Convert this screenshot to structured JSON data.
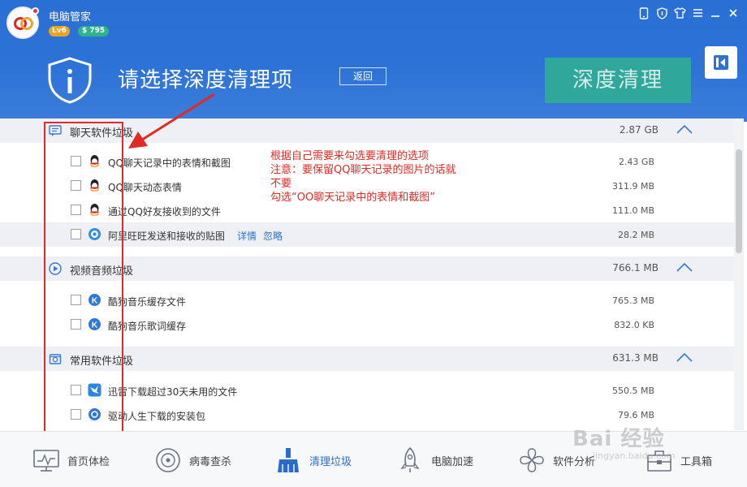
{
  "app": {
    "name": "电脑管家",
    "level_badge": "Lv6",
    "coin_badge": "$ 795"
  },
  "window_controls": [
    "phone-icon",
    "shield-icon",
    "skin-icon",
    "menu-icon",
    "minimize-icon",
    "close-icon"
  ],
  "header": {
    "title": "请选择深度清理项",
    "back_label": "返回",
    "deep_clean_label": "深度清理"
  },
  "categories": [
    {
      "label": "聊天软件垃圾",
      "size": "2.87 GB",
      "icon": "chat-icon",
      "items": [
        {
          "label": "QQ聊天记录中的表情和截图",
          "size": "2.43 GB",
          "icon": "qq-icon"
        },
        {
          "label": "QQ聊天动态表情",
          "size": "311.9 MB",
          "icon": "qq-icon"
        },
        {
          "label": "通过QQ好友接收到的文件",
          "size": "111.0 MB",
          "icon": "qq-icon"
        },
        {
          "label": "阿里旺旺发送和接收的贴图",
          "size": "28.2 MB",
          "icon": "aliwangwang-icon",
          "links": [
            "详情",
            "忽略"
          ]
        }
      ]
    },
    {
      "label": "视频音频垃圾",
      "size": "766.1 MB",
      "icon": "play-icon",
      "items": [
        {
          "label": "酷狗音乐缓存文件",
          "size": "765.3 MB",
          "icon": "kugou-icon"
        },
        {
          "label": "酷狗音乐歌词缓存",
          "size": "832.0 KB",
          "icon": "kugou-icon"
        }
      ]
    },
    {
      "label": "常用软件垃圾",
      "size": "631.3 MB",
      "icon": "software-icon",
      "items": [
        {
          "label": "迅雷下载超过30天未用的文件",
          "size": "550.5 MB",
          "icon": "xunlei-icon"
        },
        {
          "label": "驱动人生下载的安装包",
          "size": "79.6 MB",
          "icon": "driver-icon"
        }
      ]
    }
  ],
  "annotation": {
    "lines": [
      "根据自己需要来勾选要清理的选项",
      "注意：要保留QQ聊天记录的图片的话就",
      "不要",
      "勾选“OO聊天记录中的表情和截图”"
    ],
    "color": "#e02a24"
  },
  "bottom_nav": [
    {
      "label": "首页体检",
      "icon": "monitor-icon"
    },
    {
      "label": "病毒查杀",
      "icon": "target-icon"
    },
    {
      "label": "清理垃圾",
      "icon": "broom-icon",
      "active": true
    },
    {
      "label": "电脑加速",
      "icon": "rocket-icon"
    },
    {
      "label": "软件分析",
      "icon": "flower-icon"
    },
    {
      "label": "工具箱",
      "icon": "toolbox-icon"
    }
  ],
  "watermark": {
    "text": "Bai 经验",
    "sub": "jingyan.baidu.com"
  },
  "colors": {
    "header": "#2d73d6",
    "accent": "#2fa79a",
    "link": "#2b72d0"
  }
}
